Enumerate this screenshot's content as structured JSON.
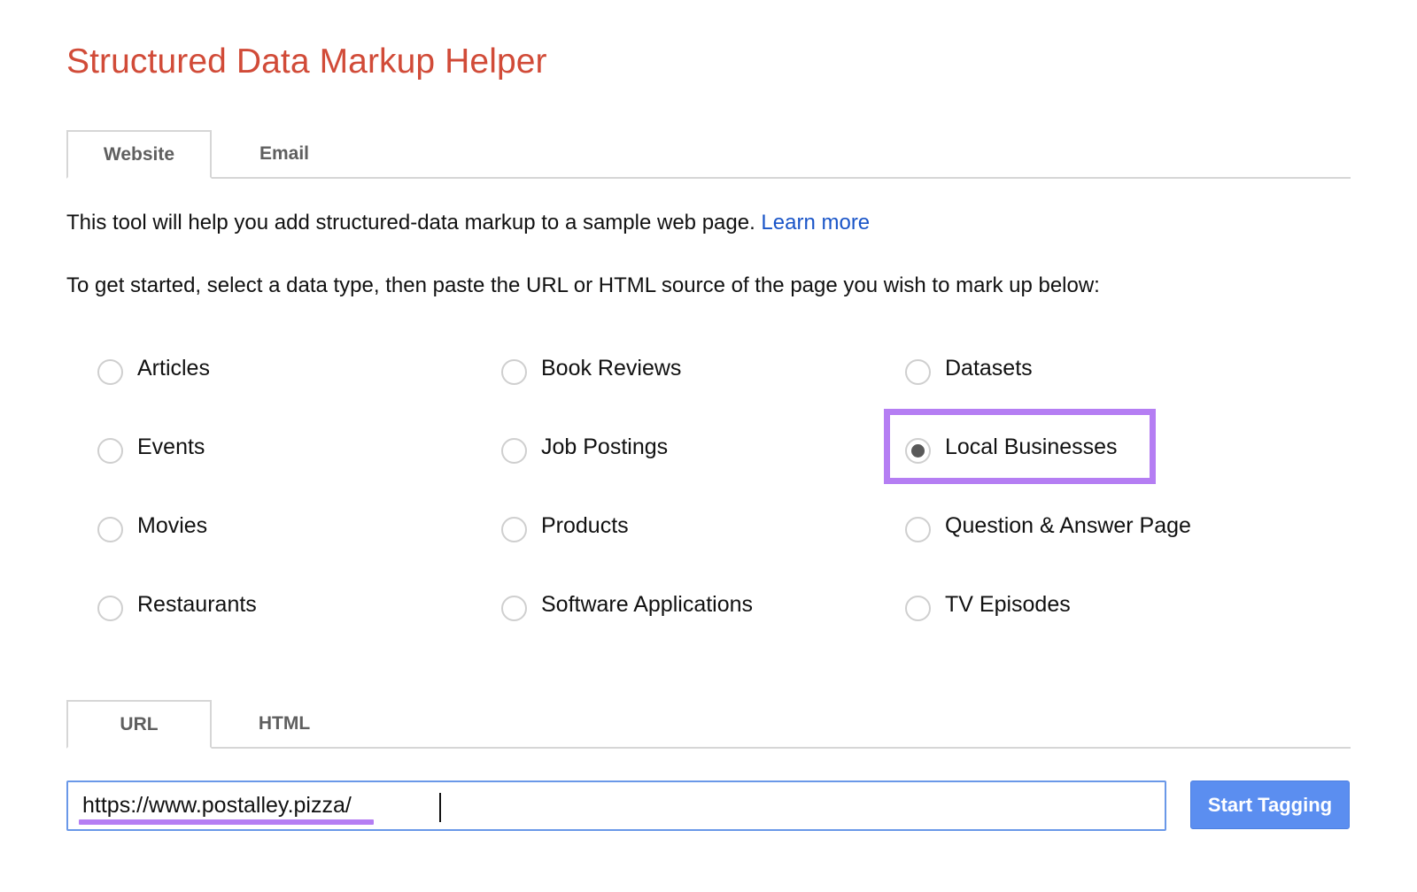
{
  "title": "Structured Data Markup Helper",
  "source_tabs": [
    {
      "label": "Website",
      "active": true
    },
    {
      "label": "Email",
      "active": false
    }
  ],
  "intro": {
    "text": "This tool will help you add structured-data markup to a sample web page.",
    "link": "Learn more"
  },
  "instructions": "To get started, select a data type, then paste the URL or HTML source of the page you wish to mark up below:",
  "data_types": [
    {
      "label": "Articles",
      "selected": false
    },
    {
      "label": "Book Reviews",
      "selected": false
    },
    {
      "label": "Datasets",
      "selected": false
    },
    {
      "label": "Events",
      "selected": false
    },
    {
      "label": "Job Postings",
      "selected": false
    },
    {
      "label": "Local Businesses",
      "selected": true
    },
    {
      "label": "Movies",
      "selected": false
    },
    {
      "label": "Products",
      "selected": false
    },
    {
      "label": "Question & Answer Page",
      "selected": false
    },
    {
      "label": "Restaurants",
      "selected": false
    },
    {
      "label": "Software Applications",
      "selected": false
    },
    {
      "label": "TV Episodes",
      "selected": false
    }
  ],
  "input_tabs": [
    {
      "label": "URL",
      "active": true
    },
    {
      "label": "HTML",
      "active": false
    }
  ],
  "url_input": {
    "value": "https://www.postalley.pizza/",
    "placeholder": ""
  },
  "start_button": "Start Tagging",
  "colors": {
    "title": "#d14b38",
    "link": "#1a55c8",
    "button": "#5b8ef0",
    "highlight": "#b57ef3"
  }
}
